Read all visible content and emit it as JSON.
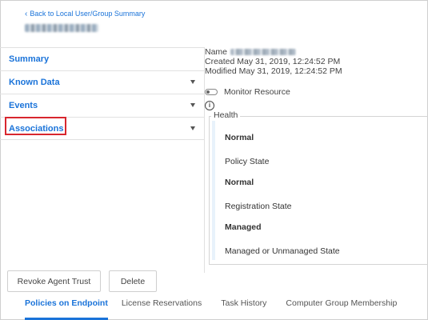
{
  "header": {
    "back_link": "Back to Local User/Group Summary"
  },
  "nav": {
    "items": [
      {
        "label": "Summary"
      },
      {
        "label": "Known Data"
      },
      {
        "label": "Events"
      },
      {
        "label": "Associations"
      }
    ]
  },
  "details": {
    "name_label": "Name",
    "created": "Created May 31, 2019, 12:24:52 PM",
    "modified": "Modified May 31, 2019, 12:24:52 PM",
    "monitor_label": "Monitor Resource",
    "monitor_enabled": false
  },
  "health": {
    "legend": "Health",
    "health_value": "Normal",
    "policy_state_label": "Policy State",
    "policy_state_value": "Normal",
    "registration_state_label": "Registration State",
    "registration_state_value": "Managed",
    "managed_state_label": "Managed or Unmanaged State"
  },
  "actions": {
    "revoke": "Revoke Agent Trust",
    "delete": "Delete"
  },
  "tabs": [
    {
      "label": "Policies on Endpoint",
      "active": true
    },
    {
      "label": "License Reservations",
      "active": false
    },
    {
      "label": "Task History",
      "active": false
    },
    {
      "label": "Computer Group Membership",
      "active": false
    }
  ],
  "colors": {
    "accent": "#1a73d9",
    "highlight": "#d8262e"
  }
}
